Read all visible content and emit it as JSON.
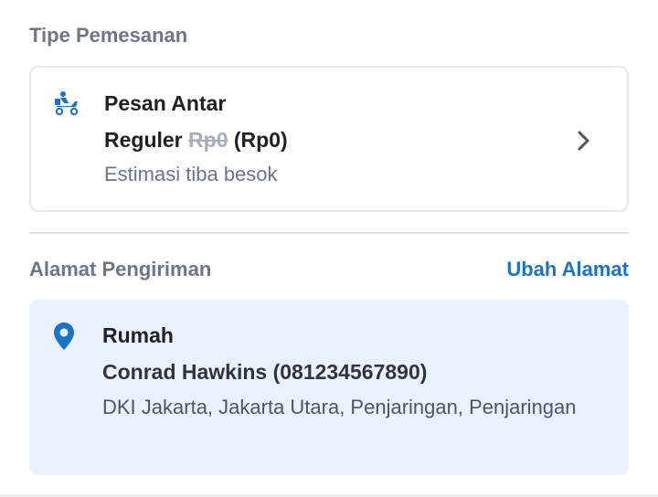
{
  "order_type": {
    "section_title": "Tipe Pemesanan",
    "method": "Pesan Antar",
    "service_name": "Reguler",
    "original_price": "Rp0",
    "final_price": "(Rp0)",
    "estimate": "Estimasi tiba besok",
    "icon": "delivery-scooter-icon"
  },
  "shipping_address": {
    "section_title": "Alamat Pengiriman",
    "change_label": "Ubah Alamat",
    "label": "Rumah",
    "recipient": "Conrad Hawkins (081234567890)",
    "detail": "DKI Jakarta, Jakarta Utara, Penjaringan, Penjaringan",
    "icon": "location-pin-icon"
  },
  "colors": {
    "accent": "#1a73c4",
    "address_card_bg": "#e8f1fd",
    "muted_text": "#6d7588"
  }
}
